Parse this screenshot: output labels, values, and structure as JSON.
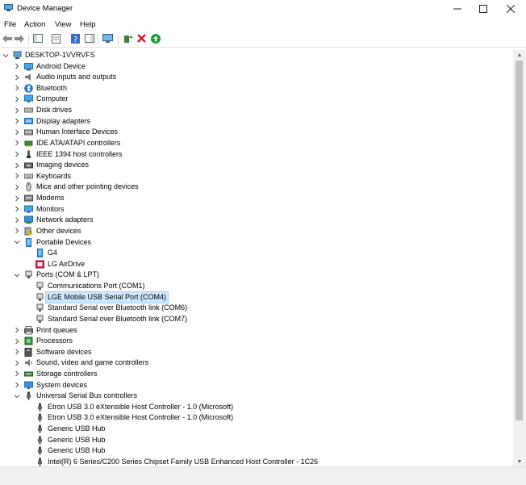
{
  "window": {
    "title": "Device Manager"
  },
  "menu": [
    "File",
    "Action",
    "View",
    "Help"
  ],
  "tree": [
    {
      "label": "DESKTOP-1VVRVFS",
      "level": 0,
      "expander": "open",
      "icon": "computer-root-icon"
    },
    {
      "label": "Android Device",
      "level": 1,
      "expander": "closed",
      "icon": "android-device-icon"
    },
    {
      "label": "Audio inputs and outputs",
      "level": 1,
      "expander": "closed",
      "icon": "speaker-icon"
    },
    {
      "label": "Bluetooth",
      "level": 1,
      "expander": "closed",
      "icon": "bluetooth-icon"
    },
    {
      "label": "Computer",
      "level": 1,
      "expander": "closed",
      "icon": "monitor-icon"
    },
    {
      "label": "Disk drives",
      "level": 1,
      "expander": "closed",
      "icon": "disk-drive-icon"
    },
    {
      "label": "Display adapters",
      "level": 1,
      "expander": "closed",
      "icon": "display-adapter-icon"
    },
    {
      "label": "Human Interface Devices",
      "level": 1,
      "expander": "closed",
      "icon": "hid-icon"
    },
    {
      "label": "IDE ATA/ATAPI controllers",
      "level": 1,
      "expander": "closed",
      "icon": "ide-controller-icon"
    },
    {
      "label": "IEEE 1394 host controllers",
      "level": 1,
      "expander": "closed",
      "icon": "ieee1394-icon"
    },
    {
      "label": "Imaging devices",
      "level": 1,
      "expander": "closed",
      "icon": "camera-icon"
    },
    {
      "label": "Keyboards",
      "level": 1,
      "expander": "closed",
      "icon": "keyboard-icon"
    },
    {
      "label": "Mice and other pointing devices",
      "level": 1,
      "expander": "closed",
      "icon": "mouse-icon"
    },
    {
      "label": "Modems",
      "level": 1,
      "expander": "closed",
      "icon": "modem-icon"
    },
    {
      "label": "Monitors",
      "level": 1,
      "expander": "closed",
      "icon": "monitor-icon"
    },
    {
      "label": "Network adapters",
      "level": 1,
      "expander": "closed",
      "icon": "network-adapter-icon"
    },
    {
      "label": "Other devices",
      "level": 1,
      "expander": "closed",
      "icon": "unknown-device-icon"
    },
    {
      "label": "Portable Devices",
      "level": 1,
      "expander": "open",
      "icon": "portable-device-icon"
    },
    {
      "label": "G4",
      "level": 2,
      "expander": "none",
      "icon": "phone-icon"
    },
    {
      "label": "LG AirDrive",
      "level": 2,
      "expander": "none",
      "icon": "lg-drive-icon"
    },
    {
      "label": "Ports (COM & LPT)",
      "level": 1,
      "expander": "open",
      "icon": "port-icon"
    },
    {
      "label": "Communications Port (COM1)",
      "level": 2,
      "expander": "none",
      "icon": "port-icon"
    },
    {
      "label": "LGE Mobile USB Serial Port (COM4)",
      "level": 2,
      "expander": "none",
      "icon": "port-icon",
      "selected": true
    },
    {
      "label": "Standard Serial over Bluetooth link (COM6)",
      "level": 2,
      "expander": "none",
      "icon": "port-icon"
    },
    {
      "label": "Standard Serial over Bluetooth link (COM7)",
      "level": 2,
      "expander": "none",
      "icon": "port-icon"
    },
    {
      "label": "Print queues",
      "level": 1,
      "expander": "closed",
      "icon": "printer-icon"
    },
    {
      "label": "Processors",
      "level": 1,
      "expander": "closed",
      "icon": "processor-icon"
    },
    {
      "label": "Software devices",
      "level": 1,
      "expander": "closed",
      "icon": "software-device-icon"
    },
    {
      "label": "Sound, video and game controllers",
      "level": 1,
      "expander": "closed",
      "icon": "sound-icon"
    },
    {
      "label": "Storage controllers",
      "level": 1,
      "expander": "closed",
      "icon": "storage-controller-icon"
    },
    {
      "label": "System devices",
      "level": 1,
      "expander": "closed",
      "icon": "system-device-icon"
    },
    {
      "label": "Universal Serial Bus controllers",
      "level": 1,
      "expander": "open",
      "icon": "usb-icon"
    },
    {
      "label": "Etron USB 3.0 eXtensible Host Controller - 1.0 (Microsoft)",
      "level": 2,
      "expander": "none",
      "icon": "usb-icon"
    },
    {
      "label": "Etron USB 3.0 eXtensible Host Controller - 1.0 (Microsoft)",
      "level": 2,
      "expander": "none",
      "icon": "usb-icon"
    },
    {
      "label": "Generic USB Hub",
      "level": 2,
      "expander": "none",
      "icon": "usb-icon"
    },
    {
      "label": "Generic USB Hub",
      "level": 2,
      "expander": "none",
      "icon": "usb-icon"
    },
    {
      "label": "Generic USB Hub",
      "level": 2,
      "expander": "none",
      "icon": "usb-icon"
    },
    {
      "label": "Intel(R) 6 Series/C200 Series Chipset Family USB Enhanced Host Controller - 1C26",
      "level": 2,
      "expander": "none",
      "icon": "usb-icon"
    }
  ]
}
